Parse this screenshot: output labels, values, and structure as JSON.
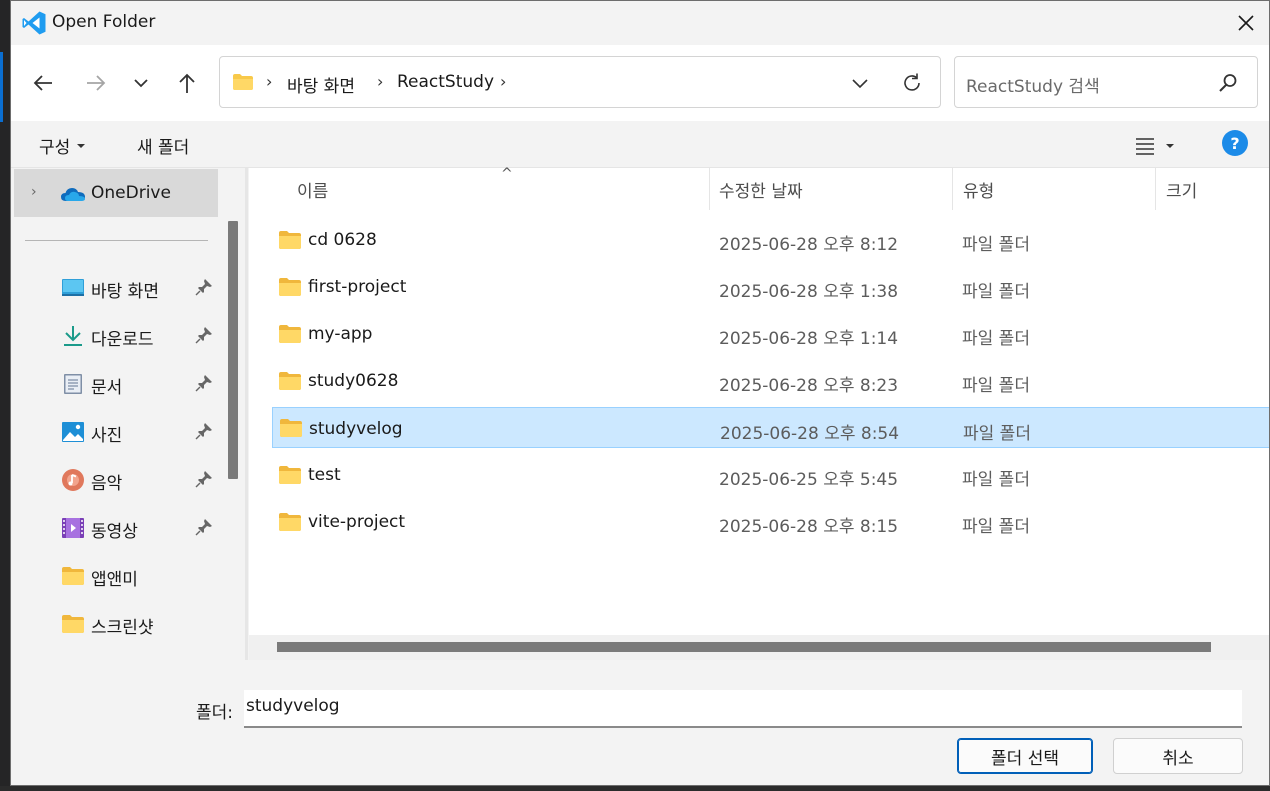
{
  "window": {
    "title": "Open Folder"
  },
  "nav": {
    "breadcrumbs": [
      "바탕 화면",
      "ReactStudy"
    ],
    "search_placeholder": "ReactStudy 검색"
  },
  "toolbar": {
    "organize_label": "구성",
    "new_folder_label": "새 폴더"
  },
  "sidebar": {
    "onedrive_label": "OneDrive",
    "items": [
      {
        "label": "바탕 화면",
        "icon": "desktop-icon",
        "pinned": true
      },
      {
        "label": "다운로드",
        "icon": "download-icon",
        "pinned": true
      },
      {
        "label": "문서",
        "icon": "document-icon",
        "pinned": true
      },
      {
        "label": "사진",
        "icon": "pictures-icon",
        "pinned": true
      },
      {
        "label": "음악",
        "icon": "music-icon",
        "pinned": true
      },
      {
        "label": "동영상",
        "icon": "videos-icon",
        "pinned": true
      },
      {
        "label": "앱앤미",
        "icon": "folder-icon",
        "pinned": false
      },
      {
        "label": "스크린샷",
        "icon": "folder-icon",
        "pinned": false
      }
    ]
  },
  "filelist": {
    "columns": [
      "이름",
      "수정한 날짜",
      "유형",
      "크기"
    ],
    "rows": [
      {
        "name": "cd 0628",
        "date": "2025-06-28 오후 8:12",
        "type": "파일 폴더",
        "selected": false
      },
      {
        "name": "first-project",
        "date": "2025-06-28 오후 1:38",
        "type": "파일 폴더",
        "selected": false
      },
      {
        "name": "my-app",
        "date": "2025-06-28 오후 1:14",
        "type": "파일 폴더",
        "selected": false
      },
      {
        "name": "study0628",
        "date": "2025-06-28 오후 8:23",
        "type": "파일 폴더",
        "selected": false
      },
      {
        "name": "studyvelog",
        "date": "2025-06-28 오후 8:54",
        "type": "파일 폴더",
        "selected": true
      },
      {
        "name": "test",
        "date": "2025-06-25 오후 5:45",
        "type": "파일 폴더",
        "selected": false
      },
      {
        "name": "vite-project",
        "date": "2025-06-28 오후 8:15",
        "type": "파일 폴더",
        "selected": false
      }
    ]
  },
  "footer": {
    "folder_label": "폴더:",
    "folder_value": "studyvelog",
    "select_button": "폴더 선택",
    "cancel_button": "취소"
  },
  "colors": {
    "accent": "#005fb8",
    "selection": "#cce8ff",
    "folder": "#f8c94a"
  }
}
